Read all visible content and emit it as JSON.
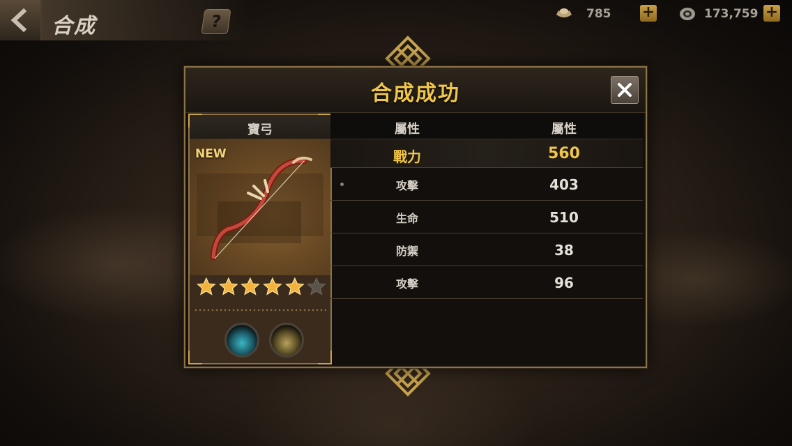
{
  "topbar": {
    "title": "合成",
    "help_label": "?",
    "currency_gold": {
      "icon": "gold-ingot-icon",
      "value": "785"
    },
    "currency_silver": {
      "icon": "silver-coin-icon",
      "value": "173,759"
    },
    "plus_label": "+"
  },
  "dialog": {
    "title": "合成成功",
    "close_icon": "close-icon",
    "item": {
      "name": "寶弓",
      "new_tag": "NEW",
      "icon": "bow-icon",
      "stars_filled": 5,
      "stars_total": 6
    },
    "stats": {
      "header_label": "屬性",
      "header_value": "屬性",
      "power": {
        "label": "戰力",
        "value": "560"
      },
      "rows": [
        {
          "label": "攻擊",
          "value": "403"
        },
        {
          "label": "生命",
          "value": "510"
        },
        {
          "label": "防禦",
          "value": "38"
        },
        {
          "label": "攻擊",
          "value": "96"
        }
      ]
    }
  },
  "colors": {
    "gold_text": "#f0c64a",
    "frame": "#8c7247"
  }
}
